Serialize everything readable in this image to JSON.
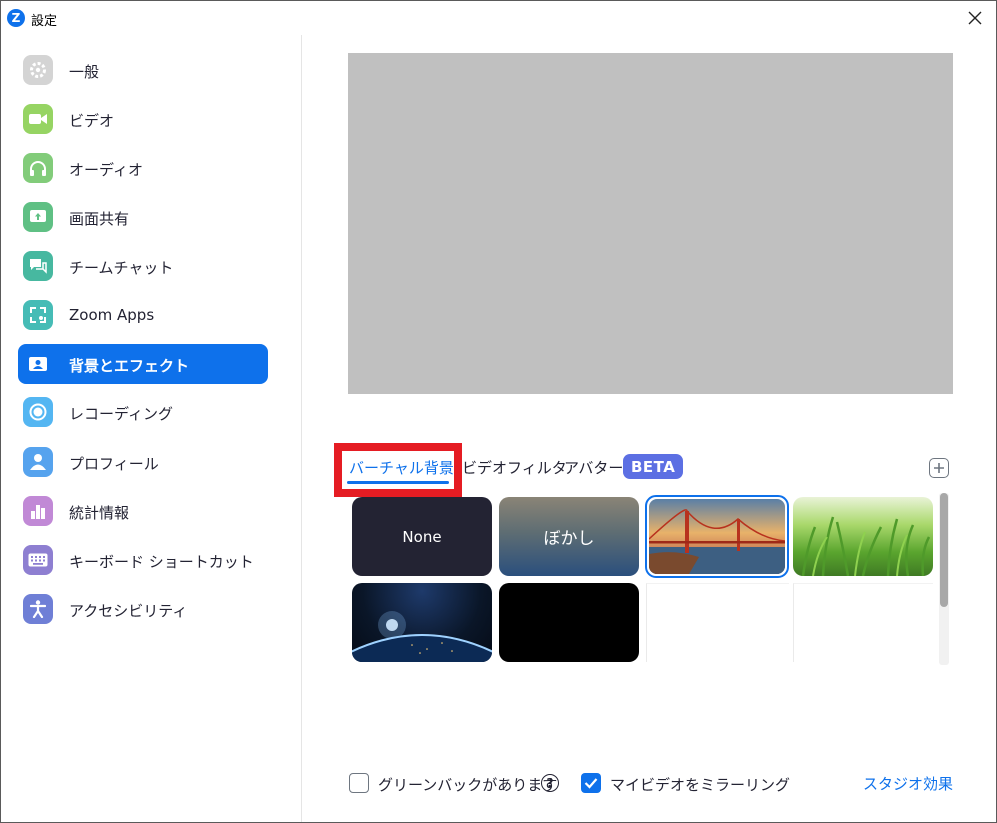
{
  "window": {
    "title": "設定",
    "app_logo_letter": "Z"
  },
  "sidebar": {
    "items": [
      {
        "label": "一般",
        "icon": "gear-icon",
        "color": "#d4d4d4"
      },
      {
        "label": "ビデオ",
        "icon": "video-camera-icon",
        "color": "#96d463"
      },
      {
        "label": "オーディオ",
        "icon": "headphones-icon",
        "color": "#82cc7a"
      },
      {
        "label": "画面共有",
        "icon": "screen-share-icon",
        "color": "#5fc084"
      },
      {
        "label": "チームチャット",
        "icon": "chat-icon",
        "color": "#47b8a0"
      },
      {
        "label": "Zoom Apps",
        "icon": "apps-icon",
        "color": "#46bcb6"
      },
      {
        "label": "背景とエフェクト",
        "icon": "background-icon",
        "color": "#0e71eb",
        "active": true
      },
      {
        "label": "レコーディング",
        "icon": "record-icon",
        "color": "#54b6f2"
      },
      {
        "label": "プロフィール",
        "icon": "profile-icon",
        "color": "#56a3ee"
      },
      {
        "label": "統計情報",
        "icon": "statistics-icon",
        "color": "#c189d6"
      },
      {
        "label": "キーボード ショートカット",
        "icon": "keyboard-icon",
        "color": "#8e7fd1"
      },
      {
        "label": "アクセシビリティ",
        "icon": "accessibility-icon",
        "color": "#6f7fd6"
      }
    ]
  },
  "tabs": {
    "virtual_background": "バーチャル背景",
    "video_filter": "ビデオフィルタ",
    "avatar": "アバター",
    "beta": "BETA"
  },
  "backgrounds": {
    "none_label": "None",
    "blur_label": "ぼかし"
  },
  "options": {
    "green_screen": "グリーンバックがあります",
    "help": "?",
    "mirror": "マイビデオをミラーリング",
    "studio_effects": "スタジオ効果"
  },
  "colors": {
    "accent": "#0e71eb",
    "highlight_box": "#e51c23",
    "preview": "#c0c0c0"
  }
}
